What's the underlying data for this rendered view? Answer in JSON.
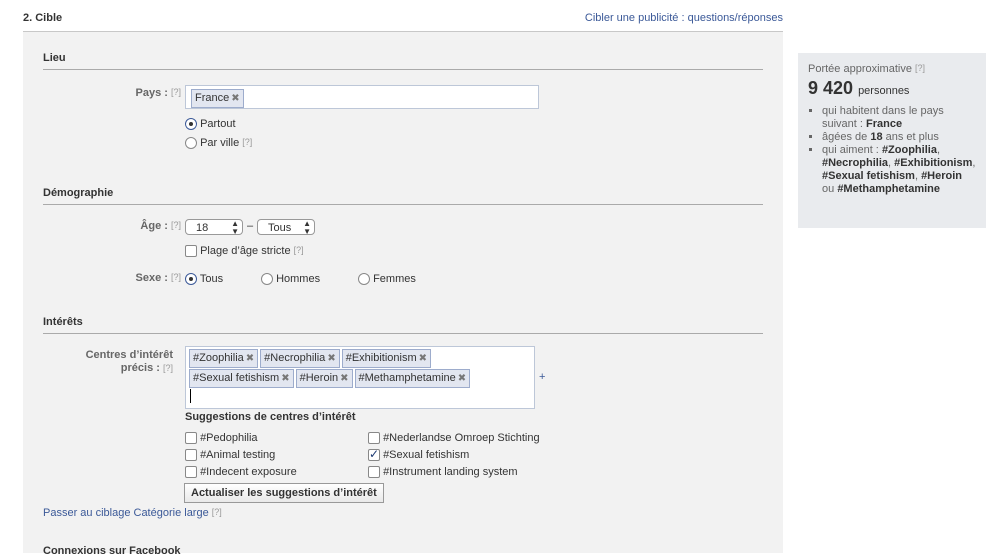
{
  "section": {
    "title": "2. Cible",
    "help_link": "Cibler une publicité : questions/réponses"
  },
  "lieu": {
    "heading": "Lieu",
    "pays_label": "Pays :",
    "pays_tokens": [
      "France"
    ],
    "partout": "Partout",
    "par_ville": "Par ville",
    "selected": "partout"
  },
  "demographie": {
    "heading": "Démographie",
    "age_label": "Âge :",
    "age_min": "18",
    "age_sep": "–",
    "age_max": "Tous",
    "strict": "Plage d’âge stricte",
    "sexe_label": "Sexe :",
    "sexe_tous": "Tous",
    "sexe_hommes": "Hommes",
    "sexe_femmes": "Femmes",
    "sexe_selected": "tous"
  },
  "interets": {
    "heading": "Intérêts",
    "label_line1": "Centres d’intérêt",
    "label_line2": "précis :",
    "tokens": [
      "#Zoophilia",
      "#Necrophilia",
      "#Exhibitionism",
      "#Sexual fetishism",
      "#Heroin",
      "#Methamphetamine"
    ],
    "plus": "+",
    "suggestions_title": "Suggestions de centres d’intérêt",
    "suggestions_left": [
      {
        "label": "#Pedophilia",
        "checked": false
      },
      {
        "label": "#Animal testing",
        "checked": false
      },
      {
        "label": "#Indecent exposure",
        "checked": false
      }
    ],
    "suggestions_right": [
      {
        "label": "#Nederlandse Omroep Stichting",
        "checked": false
      },
      {
        "label": "#Sexual fetishism",
        "checked": true
      },
      {
        "label": "#Instrument landing system",
        "checked": false
      }
    ],
    "refresh_button": "Actualiser les suggestions d’intérêt",
    "broad_link": "Passer au ciblage Catégorie large"
  },
  "connexions": {
    "heading": "Connexions sur Facebook"
  },
  "help_marker": "[?]",
  "reach": {
    "title": "Portée approximative",
    "number": "9 420",
    "unit": "personnes",
    "line1_prefix": "qui habitent dans le pays suivant :",
    "line1_value": "France",
    "line2_prefix": "âgées de",
    "line2_value": "18",
    "line2_suffix": "ans et plus",
    "line3_prefix": "qui aiment :",
    "line3_items": [
      "#Zoophilia",
      "#Necrophilia",
      "#Exhibitionism",
      "#Sexual fetishism",
      "#Heroin"
    ],
    "line3_or": "ou",
    "line3_last": "#Methamphetamine"
  }
}
